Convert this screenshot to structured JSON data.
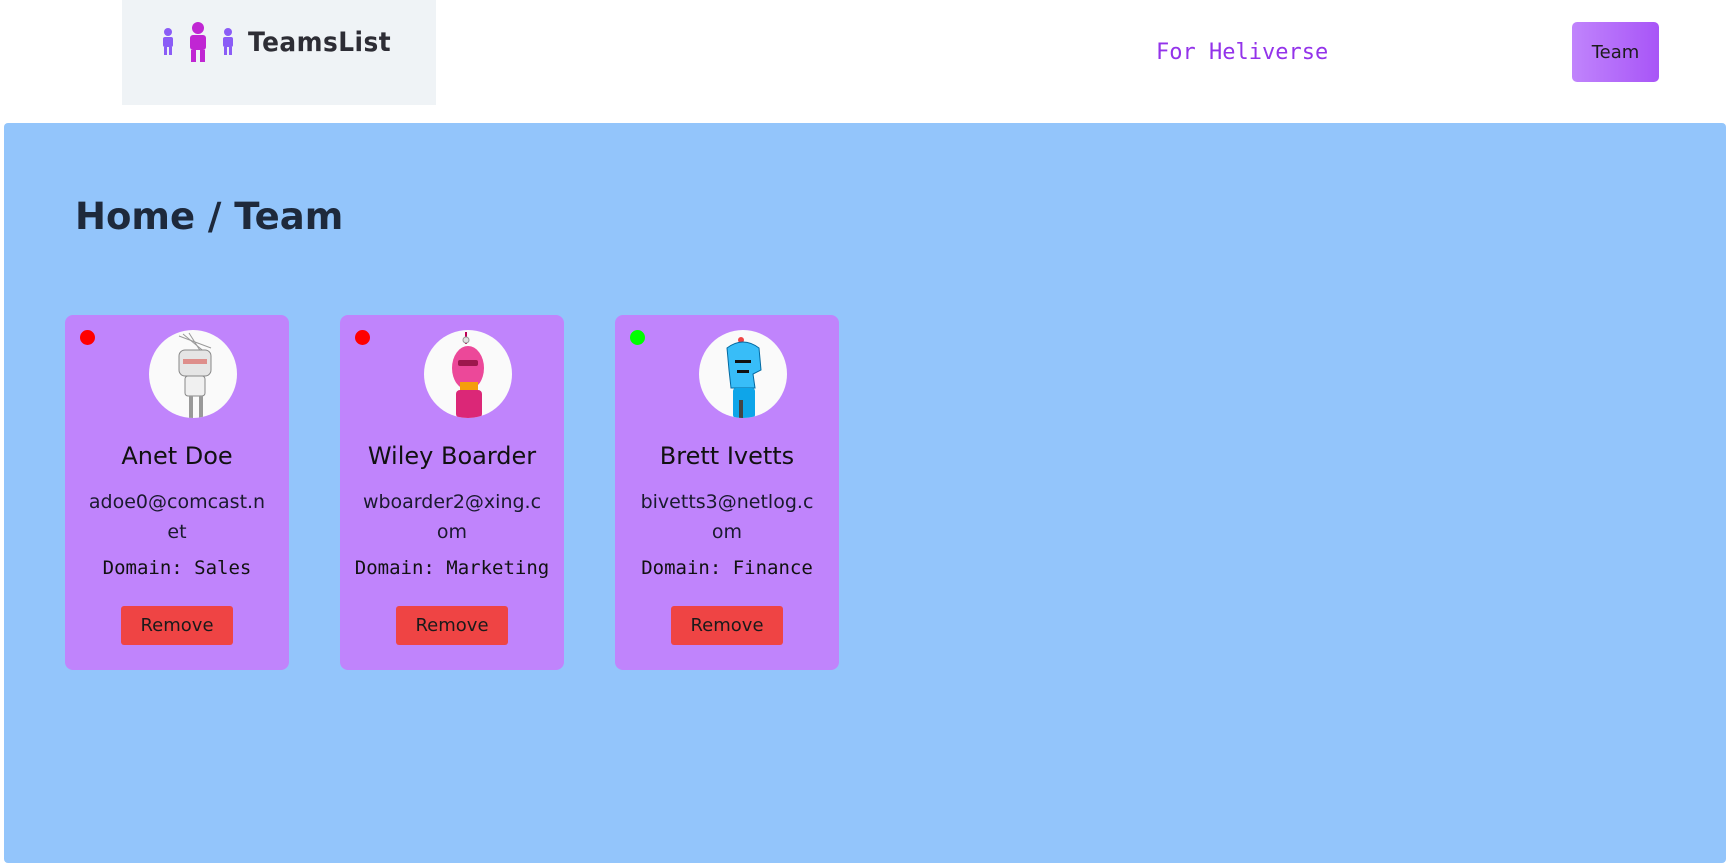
{
  "header": {
    "logo_text": "TeamsList",
    "tagline": "For Heliverse",
    "team_button_label": "Team"
  },
  "page": {
    "breadcrumb": "Home / Team"
  },
  "members": [
    {
      "name": "Anet Doe",
      "email": "adoe0@comcast.net",
      "domain": "Domain: Sales",
      "status_color": "#ff0000",
      "avatar_icon": "robot-avatar-white",
      "remove_label": "Remove"
    },
    {
      "name": "Wiley Boarder",
      "email": "wboarder2@xing.com",
      "domain": "Domain: Marketing",
      "status_color": "#ff0000",
      "avatar_icon": "robot-avatar-pink",
      "remove_label": "Remove"
    },
    {
      "name": "Brett Ivetts",
      "email": "bivetts3@netlog.com",
      "domain": "Domain: Finance",
      "status_color": "#00ff00",
      "avatar_icon": "robot-avatar-blue",
      "remove_label": "Remove"
    }
  ],
  "colors": {
    "main_background": "#93c5fb",
    "card_background": "#c084fc",
    "remove_button": "#ef4444",
    "tagline": "#9333ea"
  }
}
